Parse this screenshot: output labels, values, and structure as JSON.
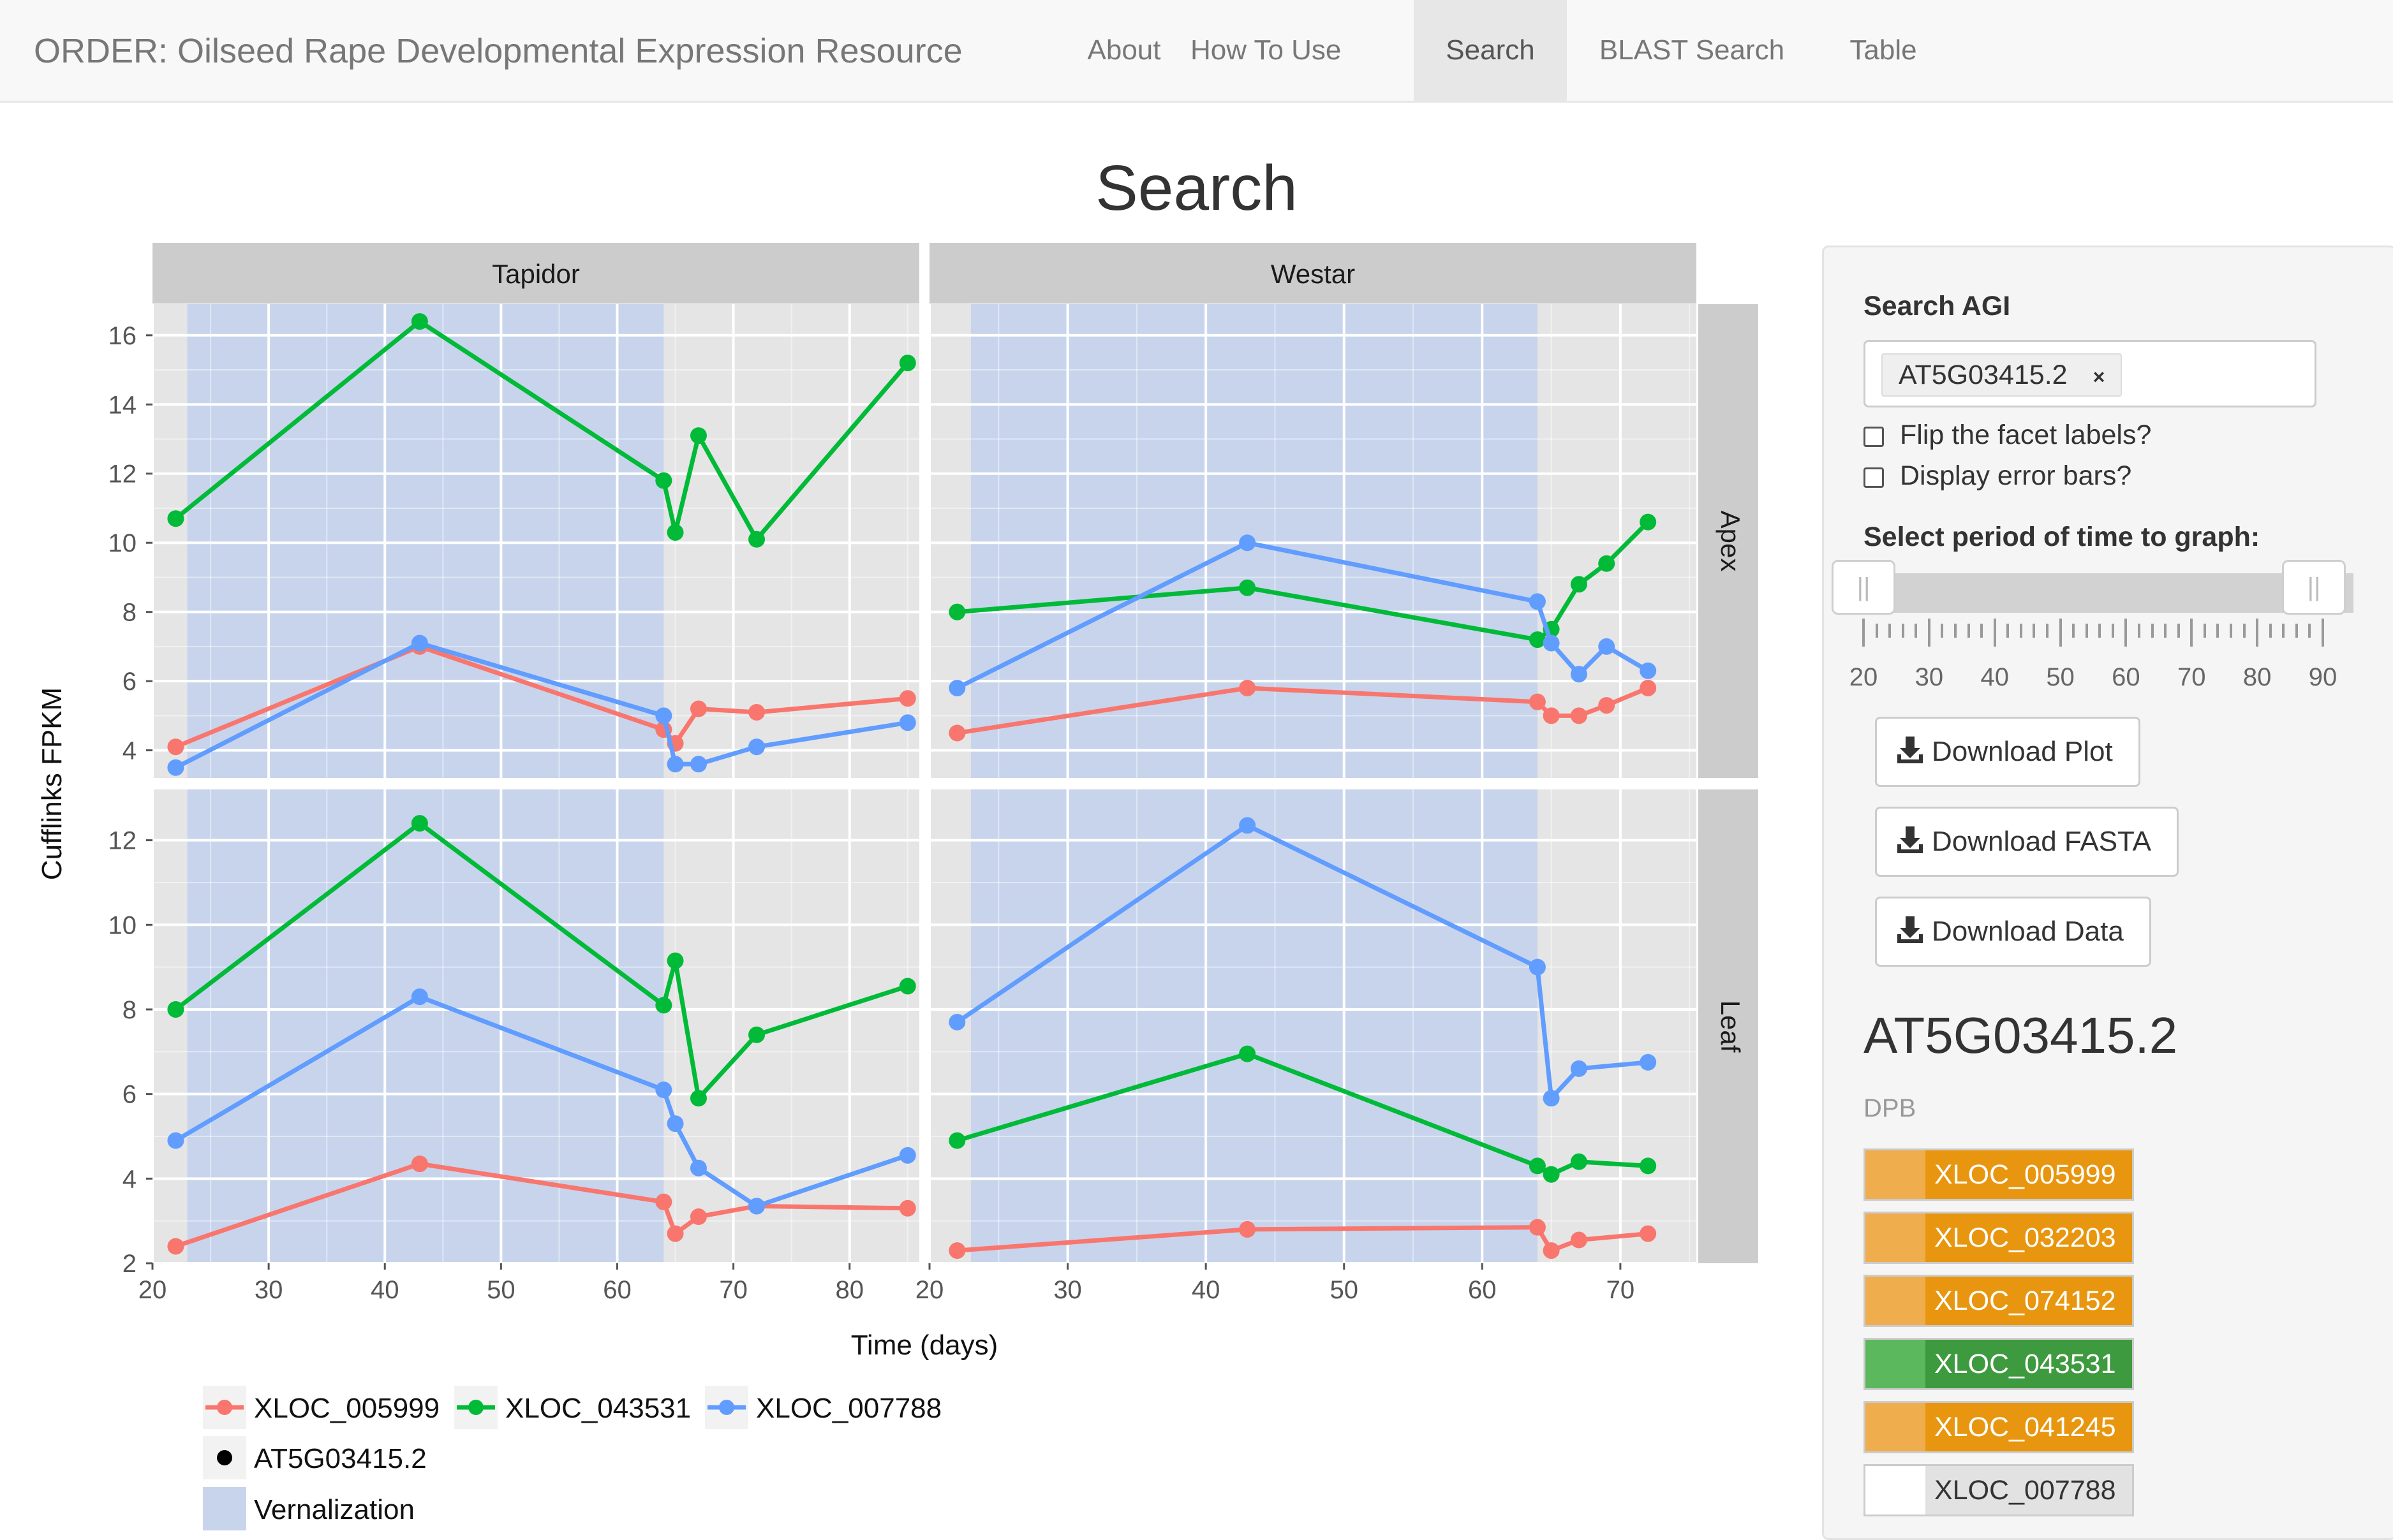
{
  "nav": {
    "brand": "ORDER: Oilseed Rape Developmental Expression Resource",
    "items": [
      {
        "label": "About",
        "active": false
      },
      {
        "label": "How To Use",
        "active": false
      },
      {
        "label": "Search",
        "active": true
      },
      {
        "label": "BLAST Search",
        "active": false
      },
      {
        "label": "Table",
        "active": false
      }
    ]
  },
  "page": {
    "title": "Search"
  },
  "sidebar": {
    "search_label": "Search AGI",
    "selected_agi": "AT5G03415.2",
    "remove_symbol": "×",
    "flip_label": "Flip the facet labels?",
    "error_bars_label": "Display error bars?",
    "period_label": "Select period of time to graph:",
    "slider": {
      "min": 20,
      "max": 90,
      "low": 20,
      "high": 90,
      "handle_glyph": "||",
      "ticks": [
        "20",
        "30",
        "40",
        "50",
        "60",
        "70",
        "80",
        "90"
      ]
    },
    "buttons": {
      "plot": "Download Plot",
      "fasta": "Download FASTA",
      "data": "Download Data"
    },
    "agi_heading": "AT5G03415.2",
    "agi_subtitle": "DPB",
    "xlocs": [
      {
        "label": "XLOC_005999",
        "color": "#e8960f",
        "swatch": "#f0ad4e",
        "text_color": "#ffffff"
      },
      {
        "label": "XLOC_032203",
        "color": "#e8960f",
        "swatch": "#f0ad4e",
        "text_color": "#ffffff"
      },
      {
        "label": "XLOC_074152",
        "color": "#e8960f",
        "swatch": "#f0ad4e",
        "text_color": "#ffffff"
      },
      {
        "label": "XLOC_043531",
        "color": "#3e9a3e",
        "swatch": "#5cb85c",
        "text_color": "#ffffff"
      },
      {
        "label": "XLOC_041245",
        "color": "#e8960f",
        "swatch": "#f0ad4e",
        "text_color": "#ffffff"
      },
      {
        "label": "XLOC_007788",
        "color": "#e2e2e2",
        "swatch": "#ffffff",
        "text_color": "#333333"
      }
    ]
  },
  "chart_data": {
    "type": "line",
    "xlabel": "Time (days)",
    "ylabel": "Cufflinks FPKM",
    "columns": [
      "Tapidor",
      "Westar"
    ],
    "rows": [
      "Apex",
      "Leaf"
    ],
    "xlim": {
      "Tapidor": [
        20,
        86
      ],
      "Westar": [
        20,
        75.5
      ]
    },
    "xticks": {
      "Tapidor": [
        20,
        30,
        40,
        50,
        60,
        70,
        80
      ],
      "Westar": [
        20,
        30,
        40,
        50,
        60,
        70
      ]
    },
    "ylim": {
      "Apex": [
        3.2,
        16.9
      ],
      "Leaf": [
        2,
        13.2
      ]
    },
    "yticks": {
      "Apex": [
        4,
        6,
        8,
        10,
        12,
        14,
        16
      ],
      "Leaf": [
        2,
        4,
        6,
        8,
        10,
        12
      ]
    },
    "vernalization": [
      23,
      64
    ],
    "colors": {
      "XLOC_005999": "#f8766d",
      "XLOC_043531": "#00ba38",
      "XLOC_007788": "#619cff",
      "vernalization": "#c7d4ec",
      "panel": "#e5e5e5",
      "strip": "#cccccc"
    },
    "legend": {
      "series": [
        "XLOC_005999",
        "XLOC_043531",
        "XLOC_007788"
      ],
      "shape_label": "AT5G03415.2",
      "fill_label": "Vernalization"
    },
    "panels": [
      {
        "col": "Tapidor",
        "row": "Apex",
        "series": [
          {
            "name": "XLOC_005999",
            "x": [
              22,
              43,
              64,
              65,
              67,
              72,
              85
            ],
            "y": [
              4.1,
              7.0,
              4.6,
              4.2,
              5.2,
              5.1,
              5.5
            ]
          },
          {
            "name": "XLOC_043531",
            "x": [
              22,
              43,
              64,
              65,
              67,
              72,
              85
            ],
            "y": [
              10.7,
              16.4,
              11.8,
              10.3,
              13.1,
              10.1,
              15.2
            ]
          },
          {
            "name": "XLOC_007788",
            "x": [
              22,
              43,
              64,
              65,
              67,
              72,
              85
            ],
            "y": [
              3.5,
              7.1,
              5.0,
              3.6,
              3.6,
              4.1,
              4.8
            ]
          }
        ]
      },
      {
        "col": "Westar",
        "row": "Apex",
        "series": [
          {
            "name": "XLOC_005999",
            "x": [
              22,
              43,
              64,
              65,
              67,
              69,
              72
            ],
            "y": [
              4.5,
              5.8,
              5.4,
              5.0,
              5.0,
              5.3,
              5.8
            ]
          },
          {
            "name": "XLOC_043531",
            "x": [
              22,
              43,
              64,
              65,
              67,
              69,
              72
            ],
            "y": [
              8.0,
              8.7,
              7.2,
              7.5,
              8.8,
              9.4,
              10.6
            ]
          },
          {
            "name": "XLOC_007788",
            "x": [
              22,
              43,
              64,
              65,
              67,
              69,
              72
            ],
            "y": [
              5.8,
              10.0,
              8.3,
              7.1,
              6.2,
              7.0,
              6.3
            ]
          }
        ]
      },
      {
        "col": "Tapidor",
        "row": "Leaf",
        "series": [
          {
            "name": "XLOC_005999",
            "x": [
              22,
              43,
              64,
              65,
              67,
              72,
              85
            ],
            "y": [
              2.4,
              4.35,
              3.45,
              2.7,
              3.1,
              3.35,
              3.3
            ]
          },
          {
            "name": "XLOC_043531",
            "x": [
              22,
              43,
              64,
              65,
              67,
              72,
              85
            ],
            "y": [
              8.0,
              12.4,
              8.1,
              9.15,
              5.9,
              7.4,
              8.55
            ]
          },
          {
            "name": "XLOC_007788",
            "x": [
              22,
              43,
              64,
              65,
              67,
              72,
              85
            ],
            "y": [
              4.9,
              8.3,
              6.1,
              5.3,
              4.25,
              3.35,
              4.55
            ]
          }
        ]
      },
      {
        "col": "Westar",
        "row": "Leaf",
        "series": [
          {
            "name": "XLOC_005999",
            "x": [
              22,
              43,
              64,
              65,
              67,
              72
            ],
            "y": [
              2.3,
              2.8,
              2.85,
              2.3,
              2.55,
              2.7
            ]
          },
          {
            "name": "XLOC_043531",
            "x": [
              22,
              43,
              64,
              65,
              67,
              72
            ],
            "y": [
              4.9,
              6.95,
              4.3,
              4.1,
              4.4,
              4.3
            ]
          },
          {
            "name": "XLOC_007788",
            "x": [
              22,
              43,
              64,
              65,
              67,
              72
            ],
            "y": [
              7.7,
              12.35,
              9.0,
              5.9,
              6.6,
              6.75
            ]
          }
        ]
      }
    ]
  }
}
